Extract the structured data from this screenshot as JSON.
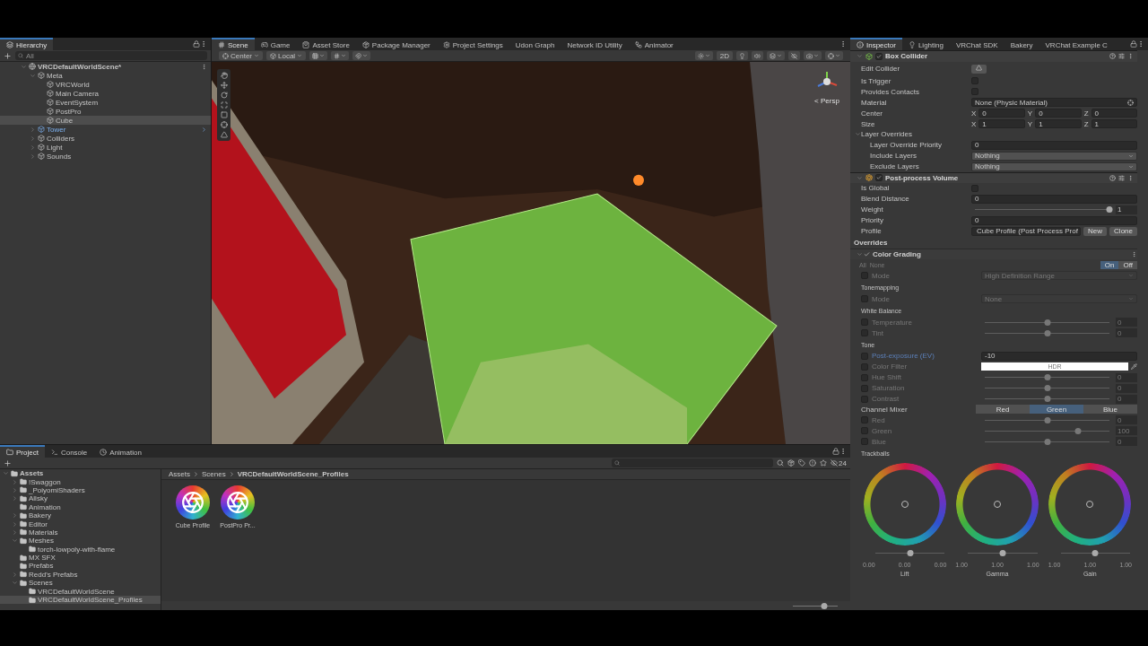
{
  "hierarchy": {
    "title": "Hierarchy",
    "search_placeholder": "All",
    "tree": [
      {
        "label": "VRCDefaultWorldScene*",
        "kind": "scene",
        "expanded": true,
        "selected": false,
        "children": [
          {
            "label": "Meta",
            "kind": "object",
            "expanded": true,
            "selected": false,
            "children": [
              {
                "label": "VRCWorld",
                "kind": "object",
                "selected": false
              },
              {
                "label": "Main Camera",
                "kind": "object",
                "selected": false
              },
              {
                "label": "EventSystem",
                "kind": "object",
                "selected": false
              },
              {
                "label": "PostPro",
                "kind": "object",
                "selected": false
              },
              {
                "label": "Cube",
                "kind": "object",
                "selected": true
              }
            ]
          },
          {
            "label": "Tower",
            "kind": "prefab",
            "expanded": false,
            "selected": false
          },
          {
            "label": "Colliders",
            "kind": "object",
            "expanded": false,
            "selected": false
          },
          {
            "label": "Light",
            "kind": "object",
            "expanded": false,
            "selected": false
          },
          {
            "label": "Sounds",
            "kind": "object",
            "expanded": false,
            "selected": false
          }
        ]
      }
    ]
  },
  "scene_tabs": [
    {
      "label": "Scene",
      "kind": "scene",
      "selected": true
    },
    {
      "label": "Game",
      "kind": "game",
      "selected": false
    },
    {
      "label": "Asset Store",
      "kind": "store",
      "selected": false
    },
    {
      "label": "Package Manager",
      "kind": "package",
      "selected": false
    },
    {
      "label": "Project Settings",
      "kind": "settings",
      "selected": false
    },
    {
      "label": "Udon Graph",
      "kind": "plain",
      "selected": false
    },
    {
      "label": "Network ID Utility",
      "kind": "plain",
      "selected": false
    },
    {
      "label": "Animator",
      "kind": "animator",
      "selected": false
    }
  ],
  "scene_toolbar": {
    "pivot": "Center",
    "space": "Local",
    "mode_2d": "2D"
  },
  "viewport": {
    "projection": "< Persp"
  },
  "inspector": {
    "tabs": [
      {
        "label": "Inspector",
        "kind": "info",
        "selected": true
      },
      {
        "label": "Lighting",
        "kind": "light",
        "selected": false
      },
      {
        "label": "VRChat SDK",
        "kind": "plain",
        "selected": false
      },
      {
        "label": "Bakery",
        "kind": "plain",
        "selected": false
      },
      {
        "label": "VRChat Example C",
        "kind": "plain",
        "selected": false
      }
    ],
    "components": [
      {
        "name": "Box Collider",
        "kind": "collider",
        "enabled": true,
        "rows": [
          {
            "kind": "button",
            "label": "Edit Collider"
          },
          {
            "kind": "checkbox",
            "label": "Is Trigger",
            "checked": false
          },
          {
            "kind": "checkbox",
            "label": "Provides Contacts",
            "checked": false
          },
          {
            "kind": "object",
            "label": "Material",
            "value": "None (Physic Material)"
          },
          {
            "kind": "vector",
            "label": "Center",
            "axes": [
              {
                "axis": "X",
                "value": "0"
              },
              {
                "axis": "Y",
                "value": "0"
              },
              {
                "axis": "Z",
                "value": "0"
              }
            ]
          },
          {
            "kind": "vector",
            "label": "Size",
            "axes": [
              {
                "axis": "X",
                "value": "1"
              },
              {
                "axis": "Y",
                "value": "1"
              },
              {
                "axis": "Z",
                "value": "1"
              }
            ]
          },
          {
            "kind": "foldout",
            "label": "Layer Overrides",
            "expanded": true,
            "rows": [
              {
                "kind": "field",
                "label": "Layer Override Priority",
                "value": "0"
              },
              {
                "kind": "dropdown",
                "label": "Include Layers",
                "value": "Nothing",
                "disabled": false
              },
              {
                "kind": "dropdown",
                "label": "Exclude Layers",
                "value": "Nothing",
                "disabled": false
              }
            ]
          }
        ]
      },
      {
        "name": "Post-process Volume",
        "kind": "postprocess",
        "enabled": true,
        "rows": [
          {
            "kind": "checkbox",
            "label": "Is Global",
            "checked": false
          },
          {
            "kind": "field",
            "label": "Blend Distance",
            "value": "0"
          },
          {
            "kind": "slider",
            "label": "Weight",
            "level": 1,
            "reading": "1"
          },
          {
            "kind": "field",
            "label": "Priority",
            "value": "0"
          },
          {
            "kind": "profile",
            "label": "Profile",
            "value": "Cube Profile (Post Process Prof",
            "buttons": [
              "New",
              "Clone"
            ]
          },
          {
            "kind": "heading",
            "label": "Overrides"
          },
          {
            "kind": "effect",
            "label": "Color Grading",
            "enabled": true
          },
          {
            "kind": "switch",
            "links": [
              "All",
              "None"
            ],
            "options": [
              {
                "label": "On",
                "selected": true
              },
              {
                "label": "Off",
                "selected": false
              }
            ]
          },
          {
            "kind": "dropdown",
            "label": "Mode",
            "value": "High Definition Range",
            "override": false,
            "disabled": true
          },
          {
            "kind": "section",
            "label": "Tonemapping"
          },
          {
            "kind": "dropdown",
            "label": "Mode",
            "value": "None",
            "override": false,
            "disabled": true
          },
          {
            "kind": "section",
            "label": "White Balance"
          },
          {
            "kind": "slider",
            "label": "Temperature",
            "override": false,
            "modified": false,
            "level": 0.5,
            "reading": "0"
          },
          {
            "kind": "slider",
            "label": "Tint",
            "override": false,
            "modified": false,
            "level": 0.5,
            "reading": "0"
          },
          {
            "kind": "section",
            "label": "Tone"
          },
          {
            "kind": "field",
            "label": "Post-exposure (EV)",
            "override": false,
            "modified": true,
            "value": "-10"
          },
          {
            "kind": "color",
            "label": "Color Filter",
            "override": false,
            "modified": false,
            "value": "HDR"
          },
          {
            "kind": "slider",
            "label": "Hue Shift",
            "override": false,
            "modified": false,
            "level": 0.5,
            "reading": "0"
          },
          {
            "kind": "slider",
            "label": "Saturation",
            "override": false,
            "modified": false,
            "level": 0.5,
            "reading": "0"
          },
          {
            "kind": "slider",
            "label": "Contrast",
            "override": false,
            "modified": false,
            "level": 0.5,
            "reading": "0"
          },
          {
            "kind": "segmented",
            "label": "Channel Mixer",
            "options": [
              {
                "label": "Red",
                "selected": false
              },
              {
                "label": "Green",
                "selected": true
              },
              {
                "label": "Blue",
                "selected": false
              }
            ]
          },
          {
            "kind": "slider",
            "label": "Red",
            "override": false,
            "modified": false,
            "level": 0.5,
            "reading": "0"
          },
          {
            "kind": "slider",
            "label": "Green",
            "override": false,
            "modified": false,
            "level": 0.75,
            "reading": "100"
          },
          {
            "kind": "slider",
            "label": "Blue",
            "override": false,
            "modified": false,
            "level": 0.5,
            "reading": "0"
          }
        ],
        "trackballs": {
          "title": "Trackballs",
          "wheels": [
            {
              "label": "Lift",
              "level": 0.5,
              "readings": [
                "0.00",
                "0.00",
                "0.00"
              ]
            },
            {
              "label": "Gamma",
              "level": 0.5,
              "readings": [
                "1.00",
                "1.00",
                "1.00"
              ]
            },
            {
              "label": "Gain",
              "level": 0.5,
              "readings": [
                "1.00",
                "1.00",
                "1.00"
              ]
            }
          ]
        }
      }
    ]
  },
  "project": {
    "tabs": [
      {
        "label": "Project",
        "kind": "folder",
        "selected": true
      },
      {
        "label": "Console",
        "kind": "console",
        "selected": false
      },
      {
        "label": "Animation",
        "kind": "clock",
        "selected": false
      }
    ],
    "tree": [
      {
        "label": "Assets",
        "expanded": true,
        "selected": false,
        "children": [
          {
            "label": "!Swaggon",
            "expanded": false,
            "selected": false
          },
          {
            "label": "_PoiyomiShaders",
            "expanded": false,
            "selected": false
          },
          {
            "label": "Allsky",
            "expanded": false,
            "selected": false
          },
          {
            "label": "Animation",
            "selected": false
          },
          {
            "label": "Bakery",
            "expanded": false,
            "selected": false
          },
          {
            "label": "Editor",
            "expanded": false,
            "selected": false
          },
          {
            "label": "Materials",
            "expanded": false,
            "selected": false
          },
          {
            "label": "Meshes",
            "expanded": true,
            "selected": false,
            "children": [
              {
                "label": "torch-lowpoly-with-flame",
                "selected": false
              }
            ]
          },
          {
            "label": "MX SFX",
            "selected": false
          },
          {
            "label": "Prefabs",
            "selected": false
          },
          {
            "label": "Redd's Prefabs",
            "expanded": false,
            "selected": false
          },
          {
            "label": "Scenes",
            "expanded": true,
            "selected": false,
            "children": [
              {
                "label": "VRCDefaultWorldScene",
                "selected": false
              },
              {
                "label": "VRCDefaultWorldScene_Profiles",
                "selected": true
              }
            ]
          }
        ]
      }
    ],
    "breadcrumb": [
      "Assets",
      "Scenes",
      "VRCDefaultWorldScene_Profiles"
    ],
    "assets": [
      {
        "label": "Cube Profile"
      },
      {
        "label": "PostPro Pr..."
      }
    ],
    "hidden_count": "24",
    "zoom": {
      "level": 0.7
    }
  }
}
